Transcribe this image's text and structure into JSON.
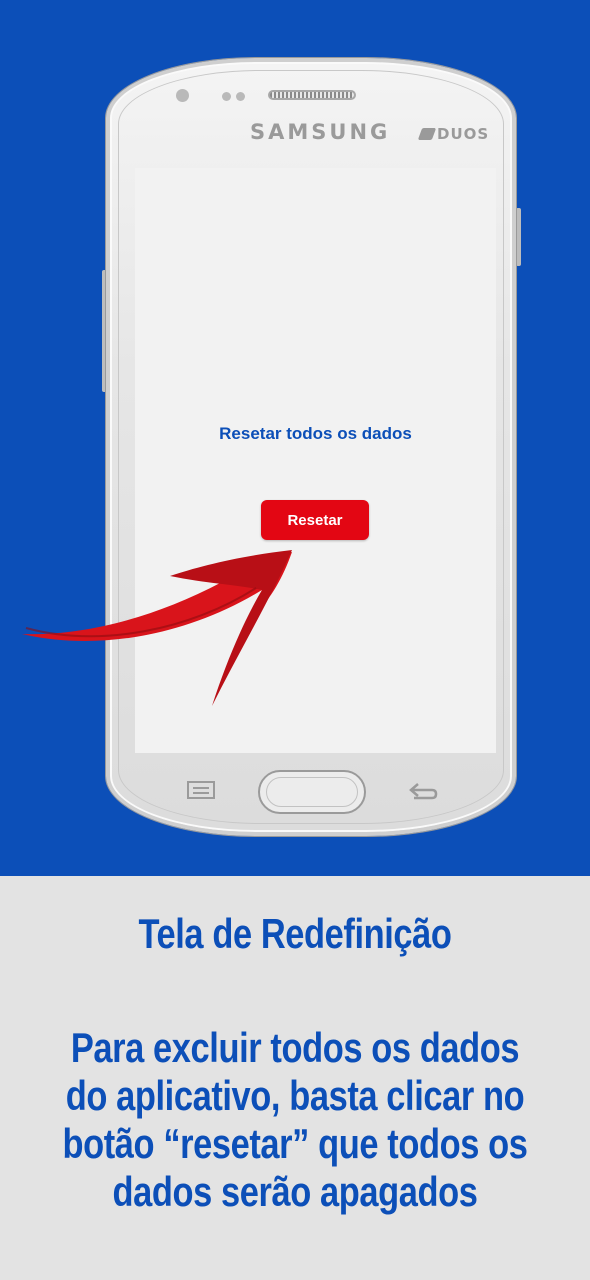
{
  "phone": {
    "brand": "SAMSUNG",
    "model_badge": "DUOS"
  },
  "screen": {
    "title": "Resetar todos os dados",
    "reset_button_label": "Resetar"
  },
  "caption": {
    "title": "Tela de Redefinição",
    "lines": [
      "Para excluir todos os dados",
      "do aplicativo, basta clicar no",
      "botão “resetar” que todos os",
      "dados serão apagados"
    ]
  },
  "colors": {
    "background_blue": "#0c4fb8",
    "accent_red": "#e30613",
    "caption_bg": "#e3e3e3"
  },
  "icons": [
    "menu-icon",
    "home-button",
    "back-icon",
    "arrow-pointer"
  ]
}
